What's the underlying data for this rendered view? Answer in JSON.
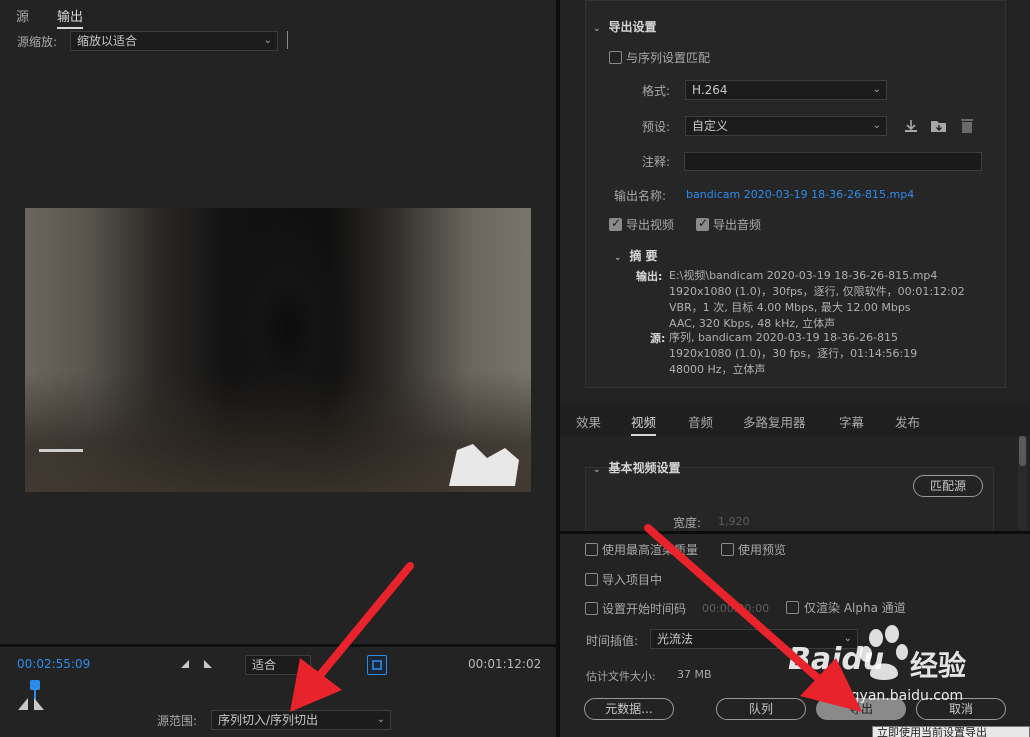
{
  "left": {
    "tabs": [
      "源",
      "输出"
    ],
    "source_scale_label": "源缩放:",
    "source_scale_value": "缩放以适合",
    "current_time": "00:02:55:09",
    "fit_value": "适合",
    "duration": "00:01:12:02",
    "source_range_label": "源范围:",
    "source_range_value": "序列切入/序列切出"
  },
  "export": {
    "section_title": "导出设置",
    "match_sequence_label": "与序列设置匹配",
    "format_label": "格式:",
    "format_value": "H.264",
    "preset_label": "预设:",
    "preset_value": "自定义",
    "comment_label": "注释:",
    "output_name_label": "输出名称:",
    "output_name_value": "bandicam 2020-03-19 18-36-26-815.mp4",
    "export_video_label": "导出视频",
    "export_audio_label": "导出音频",
    "summary_title": "摘要",
    "output_label": "输出:",
    "output_lines": [
      "E:\\视频\\bandicam 2020-03-19 18-36-26-815.mp4",
      "1920x1080 (1.0)，30fps，逐行, 仅限软件，00:01:12:02",
      "VBR，1 次, 目标 4.00 Mbps, 最大 12.00 Mbps",
      "AAC, 320 Kbps, 48  kHz, 立体声"
    ],
    "source_label": "源:",
    "source_lines": [
      "序列, bandicam 2020-03-19 18-36-26-815",
      "1920x1080 (1.0)，30 fps，逐行，01:14:56:19",
      "48000 Hz，立体声"
    ]
  },
  "tabs": [
    "效果",
    "视频",
    "音频",
    "多路复用器",
    "字幕",
    "发布"
  ],
  "video_settings": {
    "title": "基本视频设置",
    "match_source_button": "匹配源",
    "width_label": "宽度:",
    "width_value": "1,920"
  },
  "bottom": {
    "max_quality_label": "使用最高渲染质量",
    "use_preview_label": "使用预览",
    "import_label": "导入项目中",
    "set_start_tc_label": "设置开始时间码",
    "start_tc_value": "00:00:00:00",
    "alpha_only_label": "仅渲染 Alpha 通道",
    "interp_label": "时间插值:",
    "interp_value": "光流法",
    "filesize_label": "估计文件大小:",
    "filesize_value": "37 MB",
    "metadata_button": "元数据...",
    "queue_button": "队列",
    "export_button": "导出",
    "cancel_button": "取消",
    "tooltip": "立即使用当前设置导出"
  },
  "watermark": {
    "brand": "Baidu",
    "cn": "经验",
    "url": "jingyan.baidu.com"
  },
  "colors": {
    "accent_blue": "#2d8ceb",
    "arrow_red": "#e8232b"
  }
}
